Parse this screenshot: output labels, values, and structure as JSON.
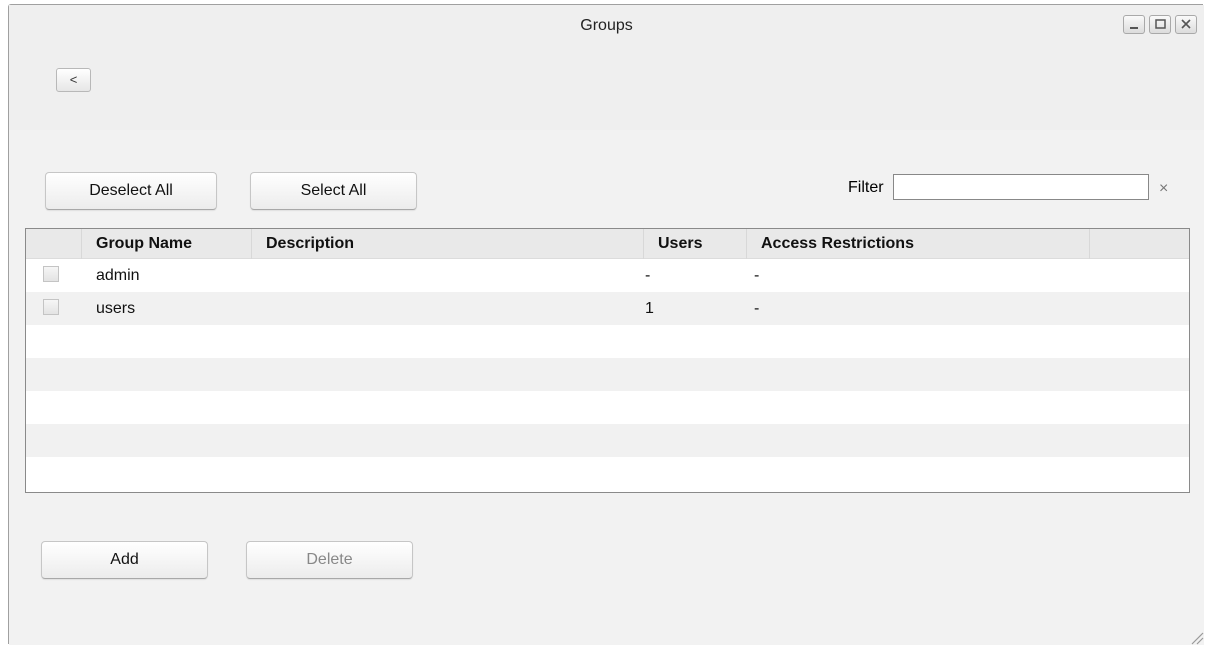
{
  "window": {
    "title": "Groups",
    "controls": [
      "minimize-icon",
      "maximize-icon",
      "close-icon"
    ]
  },
  "nav": {
    "back_label": "<"
  },
  "toolbar": {
    "deselect_all_label": "Deselect All",
    "select_all_label": "Select All",
    "filter_label": "Filter",
    "filter_value": "",
    "filter_clear_label": "×"
  },
  "table": {
    "columns": [
      "Group Name",
      "Description",
      "Users",
      "Access Restrictions"
    ],
    "rows": [
      {
        "group_name": "admin",
        "description": "",
        "users": "-",
        "access_restrictions": "-"
      },
      {
        "group_name": "users",
        "description": "",
        "users": "1",
        "access_restrictions": "-"
      }
    ]
  },
  "actions": {
    "add_label": "Add",
    "delete_label": "Delete"
  }
}
